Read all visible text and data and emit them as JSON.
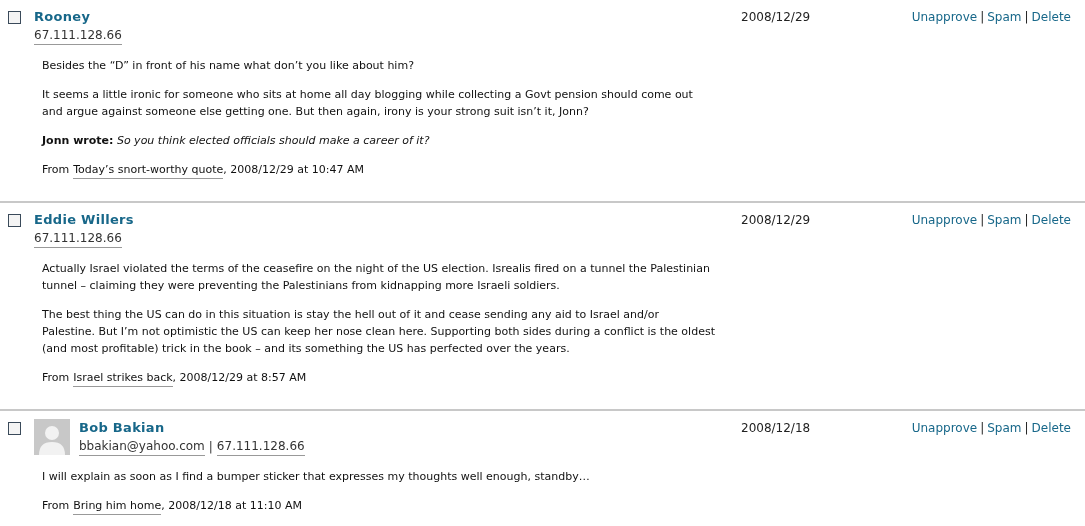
{
  "action_separator": "|",
  "comments": [
    {
      "checked": false,
      "author": "Rooney",
      "avatar": false,
      "contact": [
        "67.111.128.66"
      ],
      "date": "2008/12/29",
      "actions": [
        "Unapprove",
        "Spam",
        "Delete"
      ],
      "paragraphs": [
        "Besides the “D” in front of his name what don’t you like about him?",
        "It seems a little ironic for someone who sits at home all day blogging while collecting a Govt pension should come out and argue against someone else getting one. But then again, irony is your strong suit isn’t it, Jonn?",
        "**Jonn wrote:** *So you think elected officials should make a career of it?*"
      ],
      "from": {
        "prefix": "From",
        "post": "Today’s snort-worthy quote",
        "suffix": ", 2008/12/29 at 10:47 AM"
      }
    },
    {
      "checked": false,
      "author": "Eddie Willers",
      "avatar": false,
      "contact": [
        "67.111.128.66"
      ],
      "date": "2008/12/29",
      "actions": [
        "Unapprove",
        "Spam",
        "Delete"
      ],
      "paragraphs": [
        "Actually Israel violated the terms of the ceasefire on the night of the US election. Isrealis fired on a tunnel the Palestinian tunnel – claiming they were preventing the Palestinians from kidnapping more Israeli soldiers.",
        "The best thing the US can do in this situation is stay the hell out of it and cease sending any aid to Israel and/or Palestine. But I’m not optimistic the US can keep her nose clean here. Supporting both sides during a conflict is the oldest (and most profitable) trick in the book – and its something the US has perfected over the years."
      ],
      "from": {
        "prefix": "From",
        "post": "Israel strikes back",
        "suffix": ", 2008/12/29 at 8:57 AM"
      }
    },
    {
      "checked": false,
      "author": "Bob Bakian",
      "avatar": true,
      "contact": [
        "bbakian@yahoo.com",
        "67.111.128.66"
      ],
      "date": "2008/12/18",
      "actions": [
        "Unapprove",
        "Spam",
        "Delete"
      ],
      "paragraphs": [
        "I will explain as soon as I find a bumper sticker that expresses my thoughts well enough, standby…"
      ],
      "from": {
        "prefix": "From",
        "post": "Bring him home",
        "suffix": ", 2008/12/18 at 11:10 AM"
      }
    }
  ]
}
